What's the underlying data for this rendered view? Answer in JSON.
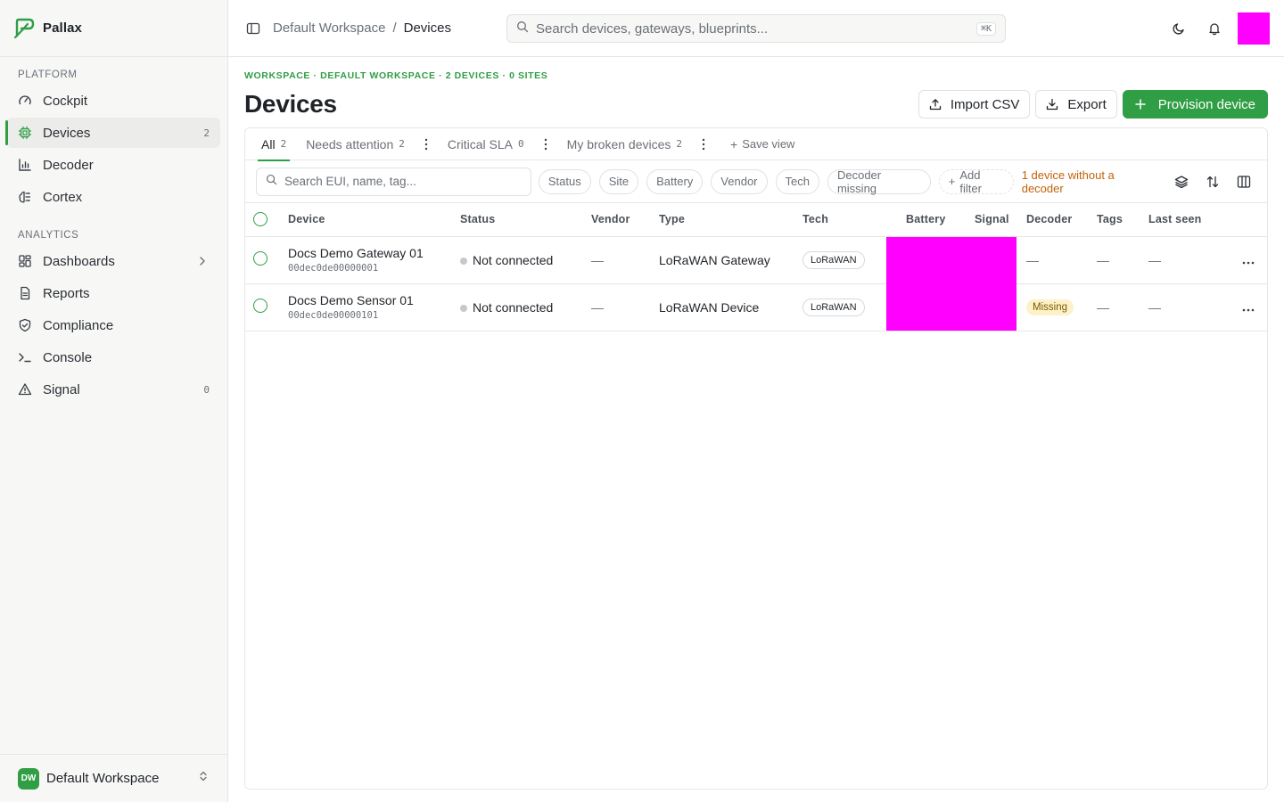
{
  "app": {
    "name": "Pallax"
  },
  "sidebar": {
    "sections": [
      {
        "title": "PLATFORM"
      },
      {
        "title": "ANALYTICS"
      }
    ],
    "items": [
      {
        "label": "Cockpit",
        "icon": "gauge-icon"
      },
      {
        "label": "Devices",
        "icon": "chip-icon",
        "count": "2",
        "active": true
      },
      {
        "label": "Decoder",
        "icon": "bar-chart-icon"
      },
      {
        "label": "Cortex",
        "icon": "brain-icon"
      },
      {
        "label": "Dashboards",
        "icon": "grid-icon"
      },
      {
        "label": "Reports",
        "icon": "document-icon"
      },
      {
        "label": "Compliance",
        "icon": "shield-icon"
      },
      {
        "label": "Console",
        "icon": "terminal-icon"
      },
      {
        "label": "Signal",
        "icon": "warning-icon",
        "count": "0"
      }
    ],
    "workspace": {
      "initials": "DW",
      "name": "Default Workspace"
    }
  },
  "topbar": {
    "breadcrumb": {
      "parent": "Default Workspace",
      "separator": "/",
      "current": "Devices"
    },
    "search": {
      "placeholder": "Search devices, gateways, blueprints...",
      "shortcut": "⌘K"
    }
  },
  "page": {
    "eyebrow": "WORKSPACE · DEFAULT WORKSPACE · 2 DEVICES · 0 SITES",
    "title": "Devices",
    "actions": {
      "import": "Import CSV",
      "export": "Export",
      "provision": "Provision device"
    }
  },
  "tabs": [
    {
      "label": "All",
      "count": "2",
      "active": true
    },
    {
      "label": "Needs attention",
      "count": "2"
    },
    {
      "label": "Critical SLA",
      "count": "0"
    },
    {
      "label": "My broken devices",
      "count": "2"
    }
  ],
  "save_view": "Save view",
  "filters": {
    "search_placeholder": "Search EUI, name, tag...",
    "chips": [
      "Status",
      "Site",
      "Battery",
      "Vendor",
      "Tech",
      "Decoder missing"
    ],
    "add_filter": "Add filter",
    "warning": "1 device without a decoder"
  },
  "table": {
    "columns": [
      "Device",
      "Status",
      "Vendor",
      "Type",
      "Tech",
      "Battery",
      "Signal",
      "Decoder",
      "Tags",
      "Last seen"
    ],
    "rows": [
      {
        "name": "Docs Demo Gateway 01",
        "eui": "00dec0de00000001",
        "status": "Not connected",
        "vendor": "—",
        "type": "LoRaWAN Gateway",
        "tech": "LoRaWAN",
        "decoder": "—",
        "tags": "—",
        "last_seen": "—"
      },
      {
        "name": "Docs Demo Sensor 01",
        "eui": "00dec0de00000101",
        "status": "Not connected",
        "vendor": "—",
        "type": "LoRaWAN Device",
        "tech": "LoRaWAN",
        "decoder": "Missing",
        "tags": "—",
        "last_seen": "—"
      }
    ]
  },
  "colors": {
    "accent": "#2f9e44",
    "warning": "#c2620a",
    "placeholder_block": "#ff00ff"
  }
}
